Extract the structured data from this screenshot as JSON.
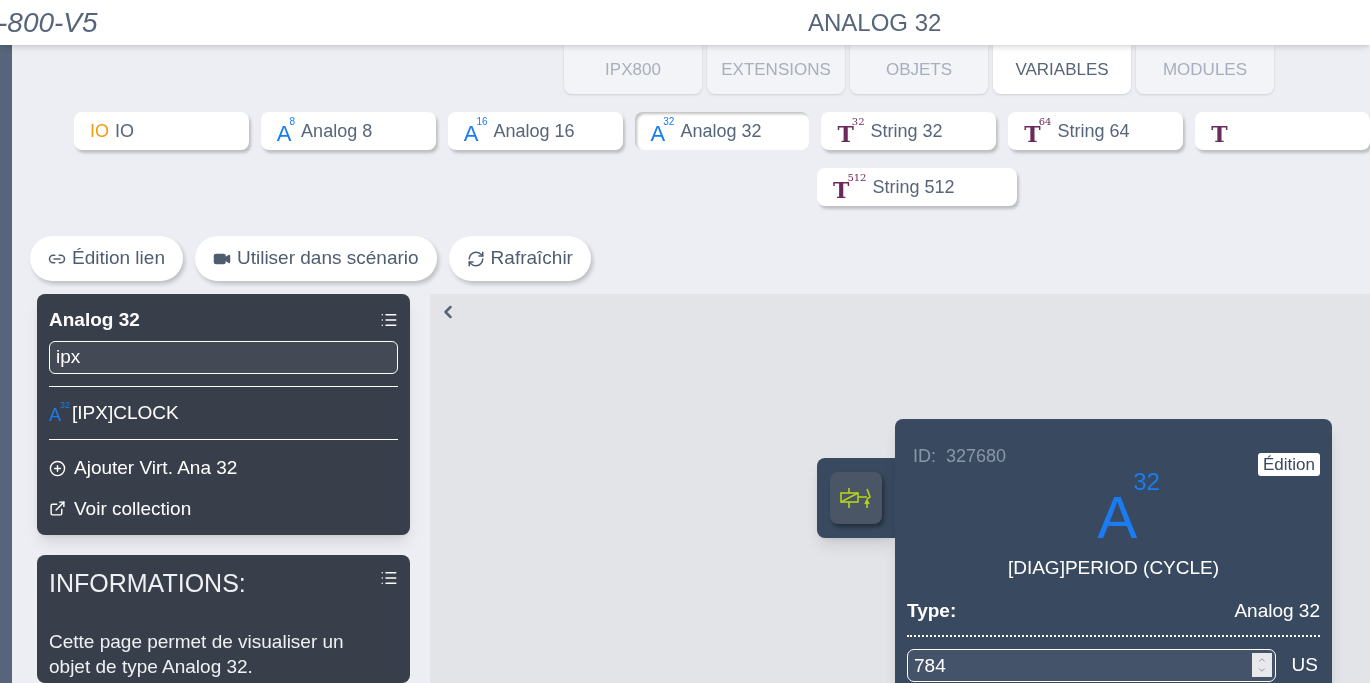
{
  "header": {
    "app_title": "-800-V5",
    "page_title": "ANALOG 32"
  },
  "tabs": [
    {
      "label": "IPX800",
      "selected": false
    },
    {
      "label": "EXTENSIONS",
      "selected": false
    },
    {
      "label": "OBJETS",
      "selected": false
    },
    {
      "label": "VARIABLES",
      "selected": true
    },
    {
      "label": "MODULES",
      "selected": false
    }
  ],
  "categories": [
    {
      "kind": "io",
      "icon": "IO",
      "label": "IO",
      "selected": false
    },
    {
      "kind": "analog",
      "icon": "A",
      "sup": "8",
      "label": "Analog 8",
      "selected": false
    },
    {
      "kind": "analog",
      "icon": "A",
      "sup": "16",
      "label": "Analog 16",
      "selected": false
    },
    {
      "kind": "analog",
      "icon": "A",
      "sup": "32",
      "label": "Analog 32",
      "selected": true
    },
    {
      "kind": "string",
      "icon": "T",
      "sup": "32",
      "label": "String 32",
      "selected": false
    },
    {
      "kind": "string",
      "icon": "T",
      "sup": "64",
      "label": "String 64",
      "selected": false
    },
    {
      "kind": "string",
      "icon": "T",
      "selected": false
    },
    {
      "kind": "string",
      "icon": "T",
      "sup": "512",
      "label": "String 512",
      "selected": false
    }
  ],
  "actions": [
    {
      "kind": "link",
      "label": "Édition lien"
    },
    {
      "kind": "video",
      "label": "Utiliser dans scénario"
    },
    {
      "kind": "refresh",
      "label": "Rafraîchir"
    }
  ],
  "list_panel": {
    "title": "Analog 32",
    "search_value": "ipx",
    "items": [
      {
        "icon": "A",
        "sup": "32",
        "label": "[IPX]CLOCK"
      }
    ],
    "links": [
      {
        "kind": "add",
        "label": "Ajouter Virt. Ana 32"
      },
      {
        "kind": "open",
        "label": "Voir collection"
      }
    ]
  },
  "info_panel": {
    "title": "INFORMATIONS:",
    "text": "Cette page permet de visualiser un objet de type Analog 32."
  },
  "detail_card": {
    "id_label": "ID:",
    "id_value": "327680",
    "edit_button": "Édition",
    "icon": "A",
    "sup": "32",
    "name": "[DIAG]PERIOD (CYCLE)",
    "type_label": "Type:",
    "type_value": "Analog 32",
    "value": "784",
    "unit": "US"
  }
}
